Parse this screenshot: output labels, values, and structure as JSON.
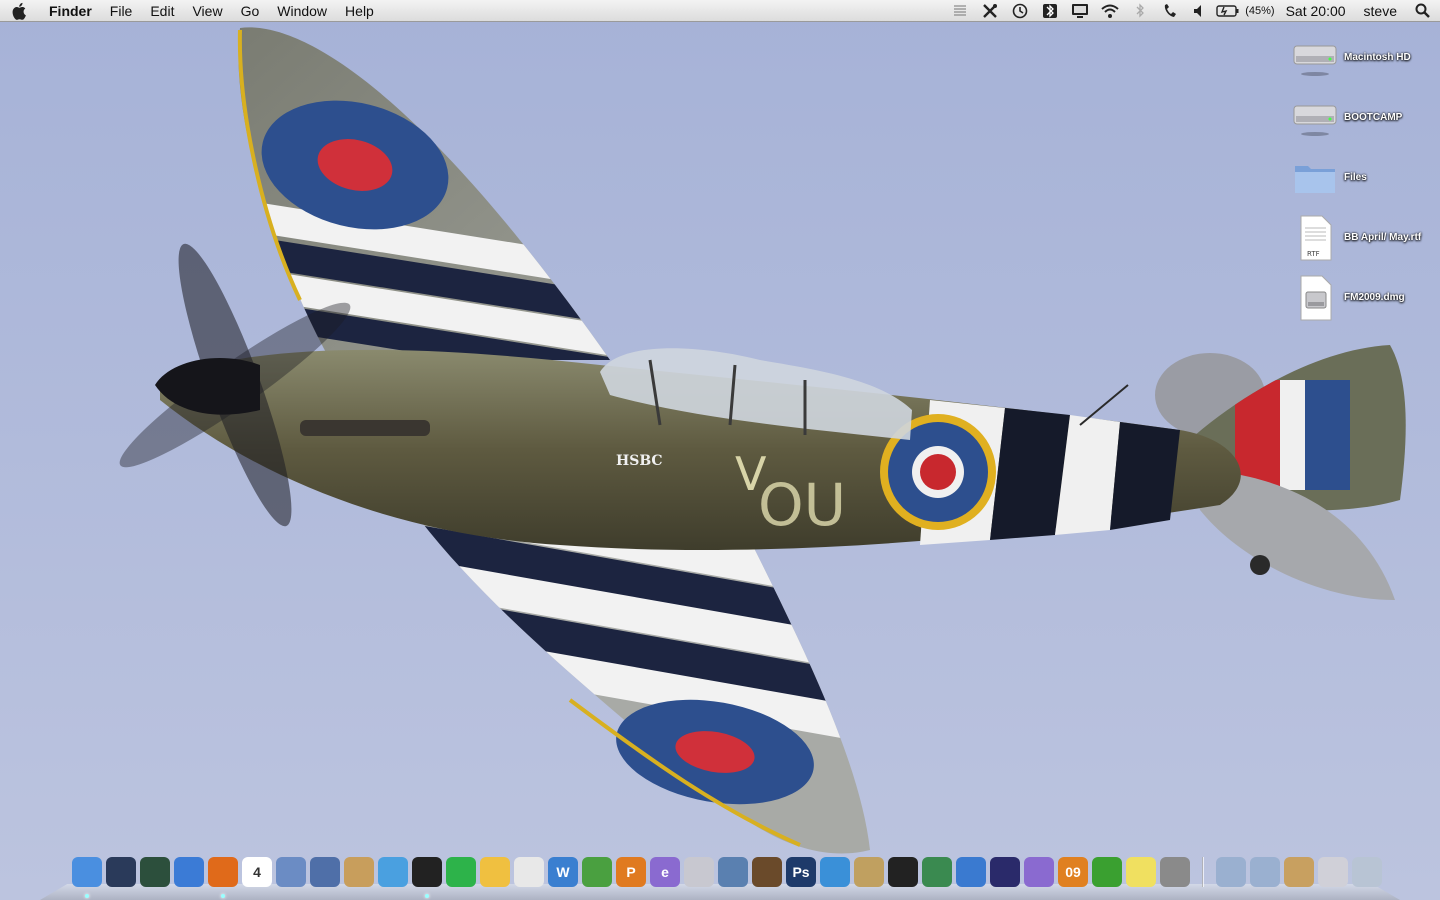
{
  "menubar": {
    "app_name": "Finder",
    "menus": [
      "File",
      "Edit",
      "View",
      "Go",
      "Window",
      "Help"
    ],
    "status": {
      "battery_percent": "(45%)",
      "clock": "Sat 20:00",
      "user": "steve"
    },
    "status_icons": [
      "menu-extra-icon",
      "tools-icon",
      "time-machine-icon",
      "bluetooth-sync-icon",
      "display-icon",
      "wifi-icon",
      "bluetooth-icon",
      "phone-icon",
      "volume-icon",
      "battery-icon",
      "spotlight-icon"
    ]
  },
  "desktop": {
    "icons": [
      {
        "label": "Macintosh HD",
        "icon": "hard-drive-icon"
      },
      {
        "label": "BOOTCAMP",
        "icon": "hard-drive-icon"
      },
      {
        "label": "Files",
        "icon": "folder-icon"
      },
      {
        "label": "BB April/ May.rtf",
        "icon": "rtf-document-icon"
      },
      {
        "label": "FM2009.dmg",
        "icon": "disk-image-icon"
      }
    ],
    "wallpaper": {
      "aircraft_text": [
        "V",
        "OU",
        "HSBC"
      ]
    }
  },
  "dock": {
    "apps": [
      {
        "name": "finder-icon",
        "running": true,
        "bg": "#4a8fe0"
      },
      {
        "name": "dashboard-icon",
        "running": false,
        "bg": "#2a3a5a"
      },
      {
        "name": "time-machine-icon",
        "running": false,
        "bg": "#2c4f3c"
      },
      {
        "name": "safari-icon",
        "running": false,
        "bg": "#3b7bd6"
      },
      {
        "name": "firefox-icon",
        "running": true,
        "bg": "#e06a1a"
      },
      {
        "name": "ical-icon",
        "running": false,
        "bg": "#ffffff",
        "text": "4"
      },
      {
        "name": "mail-icon",
        "running": false,
        "bg": "#6b8cc4"
      },
      {
        "name": "preview-icon",
        "running": false,
        "bg": "#4f6fa8"
      },
      {
        "name": "address-book-icon",
        "running": false,
        "bg": "#c89e5c"
      },
      {
        "name": "itunes-icon",
        "running": false,
        "bg": "#4aa0e0"
      },
      {
        "name": "garageband-icon",
        "running": true,
        "bg": "#222222"
      },
      {
        "name": "activity-monitor-icon",
        "running": false,
        "bg": "#2db34a"
      },
      {
        "name": "mail-stamp-icon",
        "running": false,
        "bg": "#f0c040"
      },
      {
        "name": "textedit-icon",
        "running": false,
        "bg": "#e8e8e8"
      },
      {
        "name": "word-icon",
        "running": false,
        "bg": "#3a7fd0",
        "text": "W"
      },
      {
        "name": "excel-icon",
        "running": false,
        "bg": "#4aa040"
      },
      {
        "name": "powerpoint-icon",
        "running": false,
        "bg": "#e07a20",
        "text": "P"
      },
      {
        "name": "entourage-icon",
        "running": false,
        "bg": "#8a6ad0",
        "text": "e"
      },
      {
        "name": "calendar-grid-icon",
        "running": false,
        "bg": "#c8c8d0"
      },
      {
        "name": "iphoto-icon",
        "running": false,
        "bg": "#5a80b0"
      },
      {
        "name": "photo-booth-icon",
        "running": false,
        "bg": "#6a4a2a"
      },
      {
        "name": "photoshop-icon",
        "running": false,
        "bg": "#1e3a6a",
        "text": "Ps"
      },
      {
        "name": "beach-photo-icon",
        "running": false,
        "bg": "#3a90d8"
      },
      {
        "name": "photo-stack-icon",
        "running": false,
        "bg": "#c0a060"
      },
      {
        "name": "aperture-icon",
        "running": false,
        "bg": "#222222"
      },
      {
        "name": "photo-browser-icon",
        "running": false,
        "bg": "#3a8a50"
      },
      {
        "name": "messenger-icon",
        "running": false,
        "bg": "#3a7ad0"
      },
      {
        "name": "camino-icon",
        "running": false,
        "bg": "#2a2a6a"
      },
      {
        "name": "folder-purple-icon",
        "running": false,
        "bg": "#8a6ad0"
      },
      {
        "name": "football-manager-icon",
        "running": false,
        "bg": "#e08020",
        "text": "09"
      },
      {
        "name": "utorrent-icon",
        "running": false,
        "bg": "#3aa030"
      },
      {
        "name": "stickies-icon",
        "running": false,
        "bg": "#f0e060"
      },
      {
        "name": "system-preferences-icon",
        "running": false,
        "bg": "#8a8a8a"
      }
    ],
    "stacks": [
      {
        "name": "applications-stack-icon",
        "bg": "#9ab0d0"
      },
      {
        "name": "documents-stack-icon",
        "bg": "#9ab0d0"
      },
      {
        "name": "contacts-stack-icon",
        "bg": "#c8a060"
      },
      {
        "name": "downloads-stack-icon",
        "bg": "#d0d0d8"
      },
      {
        "name": "trash-icon",
        "bg": "#b8c4d4"
      }
    ]
  }
}
